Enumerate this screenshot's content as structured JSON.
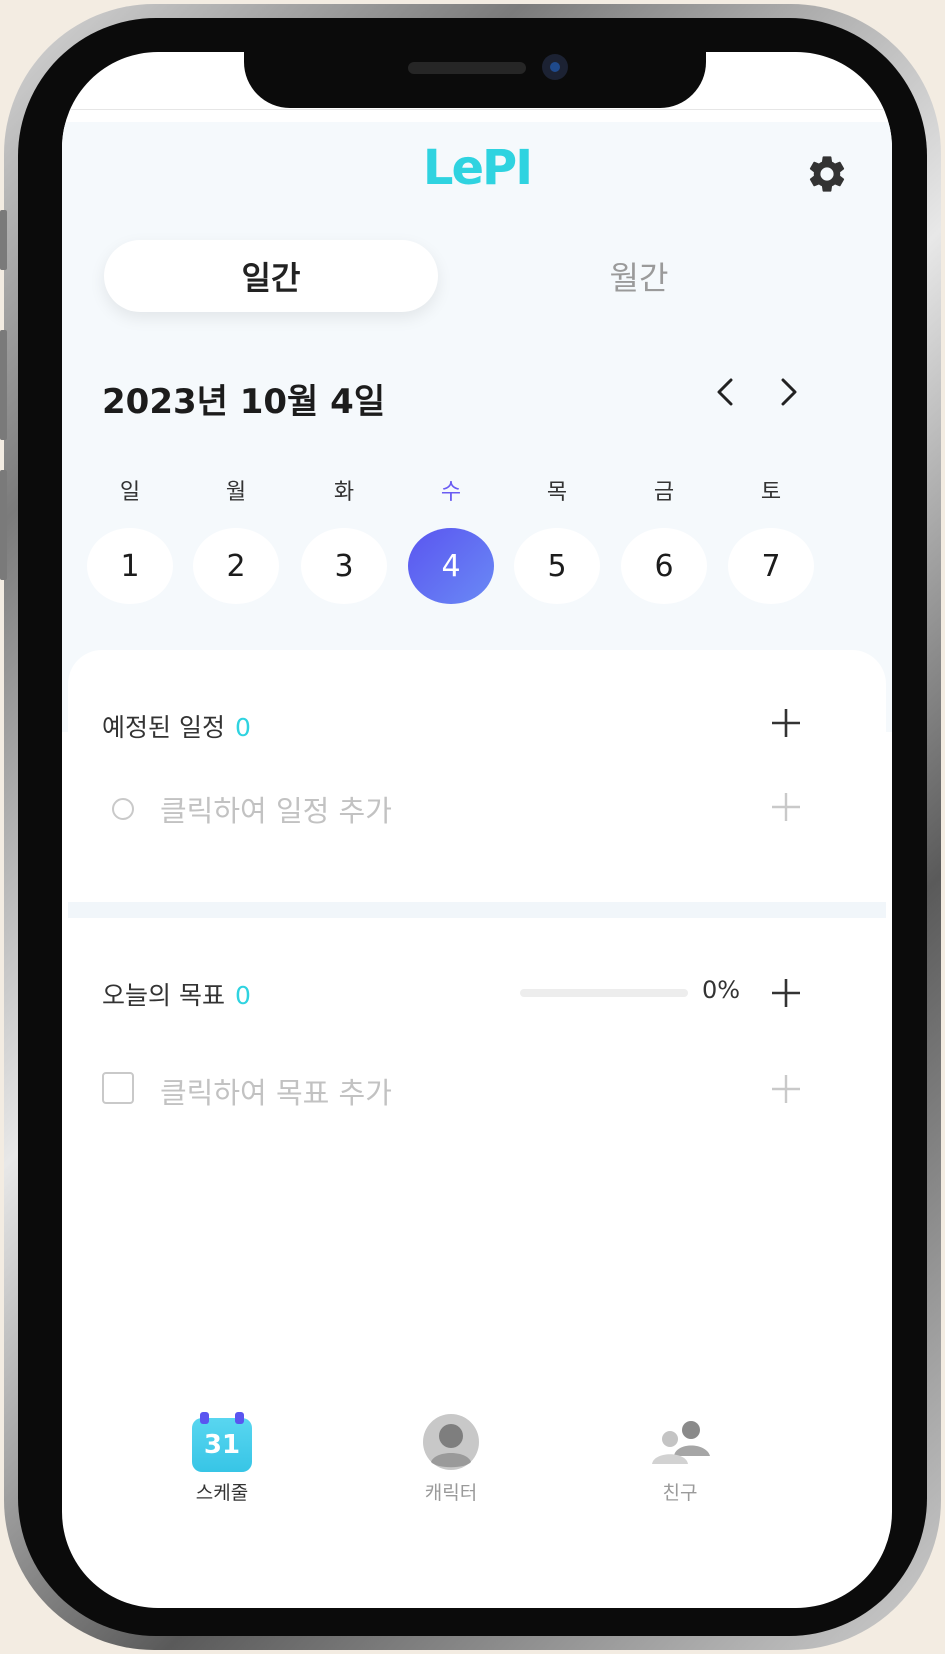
{
  "app": {
    "logo": "LePI"
  },
  "tabs": {
    "daily": "일간",
    "monthly": "월간"
  },
  "date_header": {
    "title": "2023년 10월 4일"
  },
  "week": {
    "weekdays": [
      "일",
      "월",
      "화",
      "수",
      "목",
      "금",
      "토"
    ],
    "days": [
      "1",
      "2",
      "3",
      "4",
      "5",
      "6",
      "7"
    ],
    "selected_index": 3
  },
  "schedule": {
    "title": "예정된 일정",
    "count": "0",
    "placeholder": "클릭하여 일정 추가"
  },
  "goals": {
    "title": "오늘의 목표",
    "count": "0",
    "progress_percent": 0,
    "progress_label": "0%",
    "placeholder": "클릭하여 목표 추가"
  },
  "bottom_nav": {
    "schedule_label": "스케줄",
    "schedule_icon_number": "31",
    "character_label": "캐릭터",
    "friends_label": "친구"
  },
  "colors": {
    "accent_cyan": "#2fd3e0",
    "accent_purple": "#6a5cf2",
    "background_light": "#f5f9fc"
  },
  "icons": [
    "gear-icon",
    "chevron-left-icon",
    "chevron-right-icon",
    "plus-icon",
    "calendar-icon",
    "character-icon",
    "friends-icon"
  ]
}
